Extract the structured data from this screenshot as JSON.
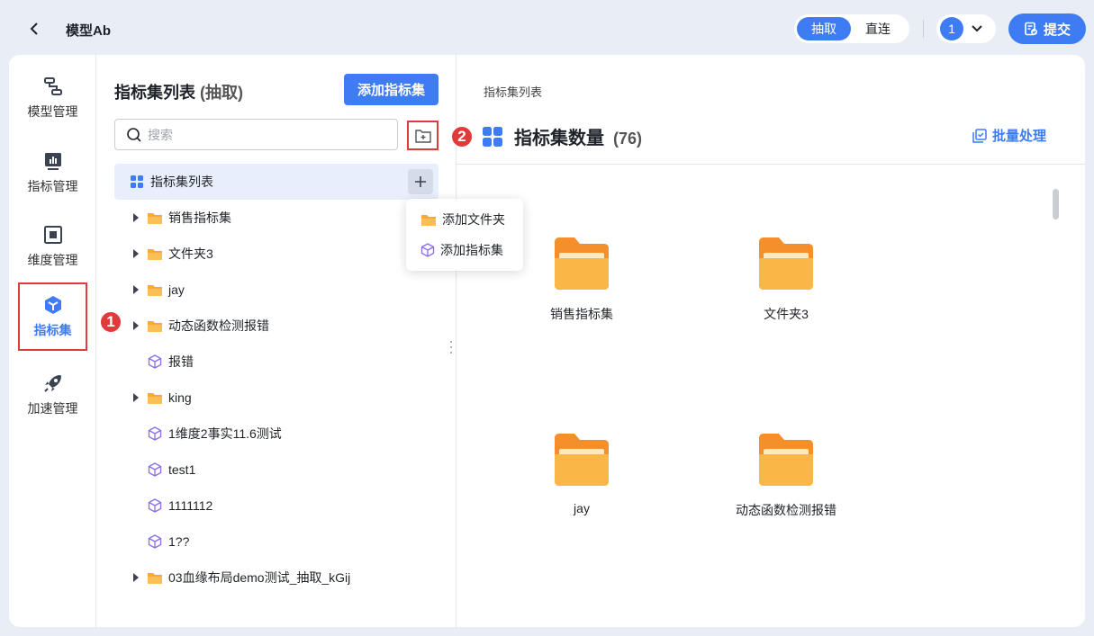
{
  "header": {
    "title": "模型Ab",
    "mode_options": [
      "抽取",
      "直连"
    ],
    "active_mode": "抽取",
    "user_badge": "1",
    "submit_label": "提交"
  },
  "rail": {
    "items": [
      {
        "label": "模型管理",
        "icon": "model-icon",
        "active": false
      },
      {
        "label": "指标管理",
        "icon": "metric-chart-icon",
        "active": false
      },
      {
        "label": "维度管理",
        "icon": "dimension-icon",
        "active": false
      },
      {
        "label": "指标集",
        "icon": "cube-icon",
        "active": true
      },
      {
        "label": "加速管理",
        "icon": "rocket-icon",
        "active": false
      }
    ]
  },
  "tree_panel": {
    "title": "指标集列表",
    "title_suffix": "(抽取)",
    "add_button": "添加指标集",
    "search_placeholder": "搜索",
    "root_label": "指标集列表",
    "items": [
      {
        "label": "销售指标集",
        "type": "folder"
      },
      {
        "label": "文件夹3",
        "type": "folder"
      },
      {
        "label": "jay",
        "type": "folder"
      },
      {
        "label": "动态函数检测报错",
        "type": "folder"
      },
      {
        "label": "报错",
        "type": "set"
      },
      {
        "label": "king",
        "type": "folder"
      },
      {
        "label": "1维度2事实11.6测试",
        "type": "set"
      },
      {
        "label": "test1",
        "type": "set"
      },
      {
        "label": "1111112",
        "type": "set"
      },
      {
        "label": "1??",
        "type": "set"
      },
      {
        "label": "03血缘布局demo测试_抽取_kGij",
        "type": "folder"
      }
    ]
  },
  "context_menu": {
    "items": [
      "添加文件夹",
      "添加指标集"
    ]
  },
  "annotations": {
    "badge1": "1",
    "badge2": "2"
  },
  "content": {
    "breadcrumb": "指标集列表",
    "title": "指标集数量",
    "count": "(76)",
    "batch_label": "批量处理",
    "cards": [
      {
        "label": "销售指标集"
      },
      {
        "label": "文件夹3"
      },
      {
        "label": "jay"
      },
      {
        "label": "动态函数检测报错"
      }
    ]
  },
  "colors": {
    "accent": "#3d7cf2",
    "highlight": "#e03a3a",
    "folder": "#f8a93a"
  }
}
